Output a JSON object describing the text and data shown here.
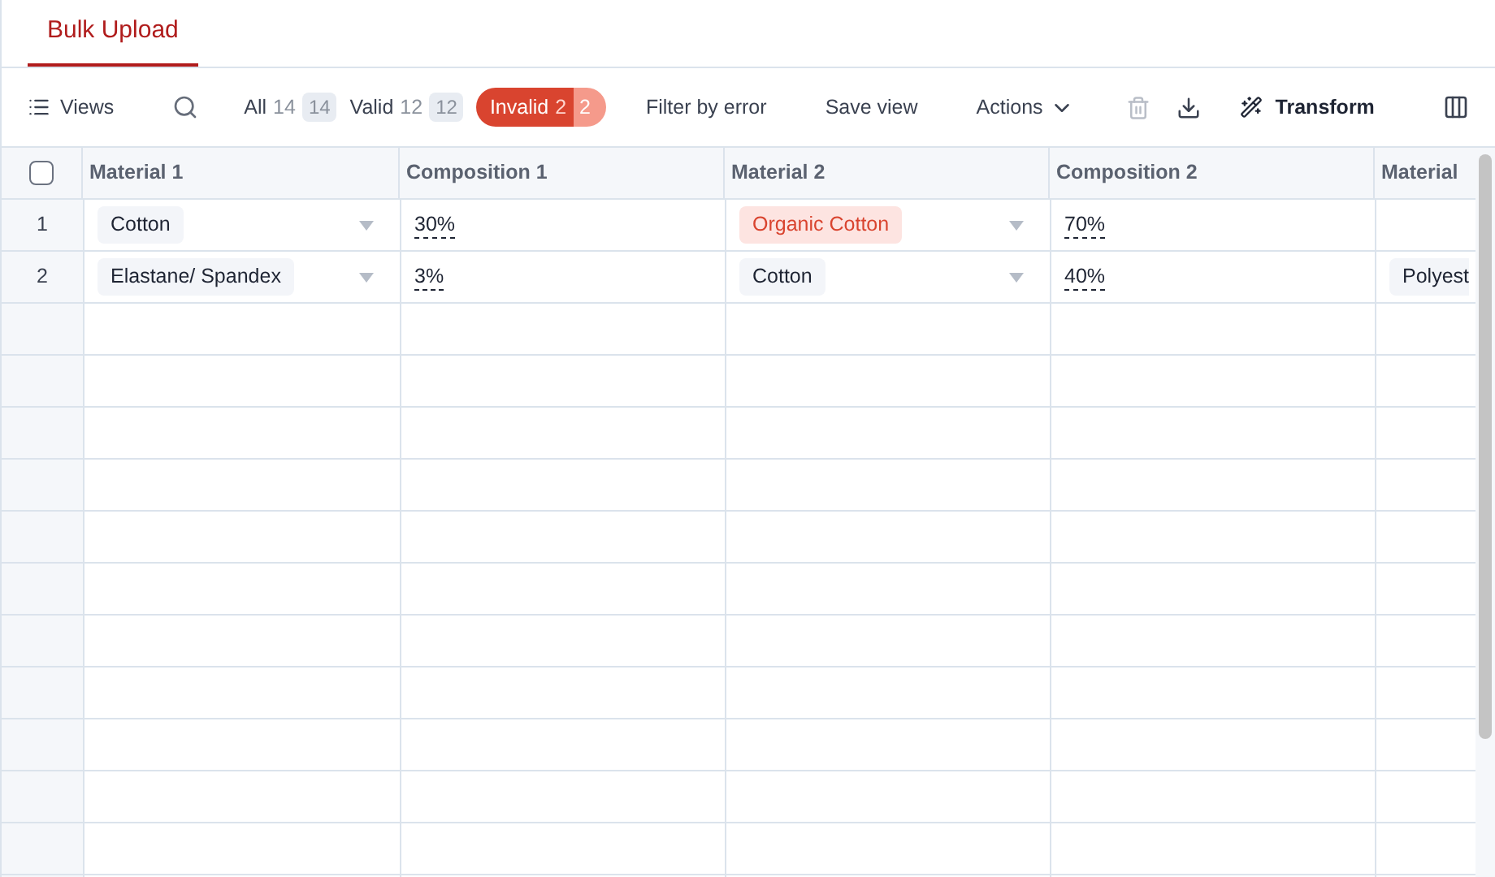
{
  "tabs": [
    {
      "label": "Bulk Upload",
      "selected": true
    }
  ],
  "toolbar": {
    "views": "Views",
    "filters": [
      {
        "label": "All",
        "count": "14",
        "badge": "14",
        "selected": false
      },
      {
        "label": "Valid",
        "count": "12",
        "badge": "12",
        "selected": false
      },
      {
        "label": "Invalid",
        "count": "2",
        "badge": "2",
        "selected": true
      }
    ],
    "filter_by_error": "Filter by error",
    "save_view": "Save view",
    "actions": "Actions",
    "icon_buttons": [
      {
        "kind": "delete",
        "disabled": true
      },
      {
        "kind": "download",
        "disabled": false
      }
    ],
    "transform": "Transform"
  },
  "table": {
    "select_all": {
      "checked": false
    },
    "columns": [
      "Material 1",
      "Composition 1",
      "Material 2",
      "Composition 2",
      "Material"
    ],
    "rows": [
      {
        "number": "1",
        "cells": [
          {
            "kind": "select",
            "value": "Cotton",
            "error": false
          },
          {
            "kind": "percent",
            "value": "30%"
          },
          {
            "kind": "select",
            "value": "Organic Cotton",
            "error": true
          },
          {
            "kind": "percent",
            "value": "70%"
          },
          {
            "kind": "empty"
          }
        ]
      },
      {
        "number": "2",
        "cells": [
          {
            "kind": "select",
            "value": "Elastane/ Spandex",
            "error": false
          },
          {
            "kind": "percent",
            "value": "3%"
          },
          {
            "kind": "select",
            "value": "Cotton",
            "error": false
          },
          {
            "kind": "percent",
            "value": "40%"
          },
          {
            "kind": "chip",
            "value": "Polyest",
            "error": false
          }
        ]
      }
    ]
  }
}
